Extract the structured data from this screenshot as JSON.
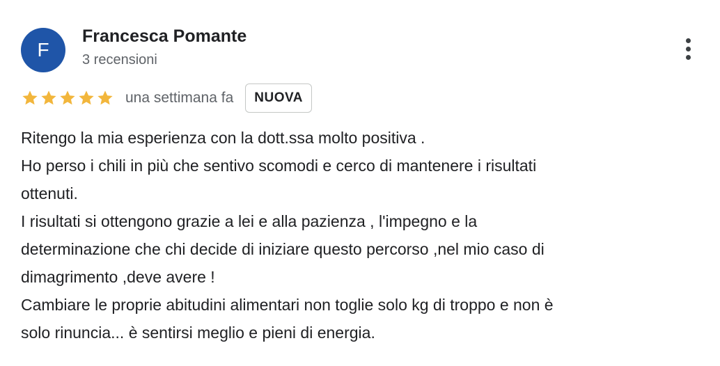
{
  "review": {
    "author": {
      "initial": "F",
      "name": "Francesca Pomante",
      "review_count": "3 recensioni",
      "avatar_color": "#1f55a8"
    },
    "rating": {
      "stars": 5,
      "max": 5,
      "star_color": "#f2b63c",
      "icon": "star-icon"
    },
    "date": "una settimana fa",
    "badge": "NUOVA",
    "menu_icon": "more-vert-icon",
    "lines": [
      "Ritengo la mia esperienza con la dott.ssa molto positiva .",
      "Ho perso i chili in più che sentivo scomodi e cerco di mantenere i risultati",
      "ottenuti.",
      "I risultati si ottengono grazie a lei e alla pazienza , l'impegno e la",
      "determinazione che chi decide di iniziare questo percorso ,nel mio caso di",
      "dimagrimento ,deve avere !",
      "Cambiare le proprie abitudini alimentari non toglie solo kg di troppo e non è",
      "solo rinuncia... è sentirsi meglio e pieni di energia."
    ]
  }
}
